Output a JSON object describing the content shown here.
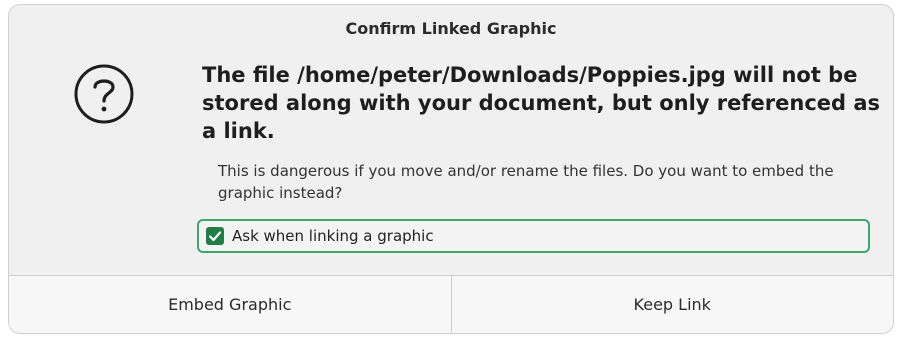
{
  "dialog": {
    "title": "Confirm Linked Graphic",
    "icon": "question-circle-icon",
    "primary_text": "The file /home/peter/Downloads/Poppies.jpg will not be stored along with your document, but only referenced as a link.",
    "secondary_text": "This is dangerous if you move and/or rename the files. Do you want to embed the graphic instead?",
    "checkbox": {
      "label": "Ask when linking a graphic",
      "checked": true
    },
    "buttons": {
      "embed_label": "Embed Graphic",
      "keep_label": "Keep Link"
    }
  },
  "colors": {
    "accent": "#3aa76d",
    "checkbox_fill": "#1f7d45",
    "background": "#f0f0f0"
  }
}
